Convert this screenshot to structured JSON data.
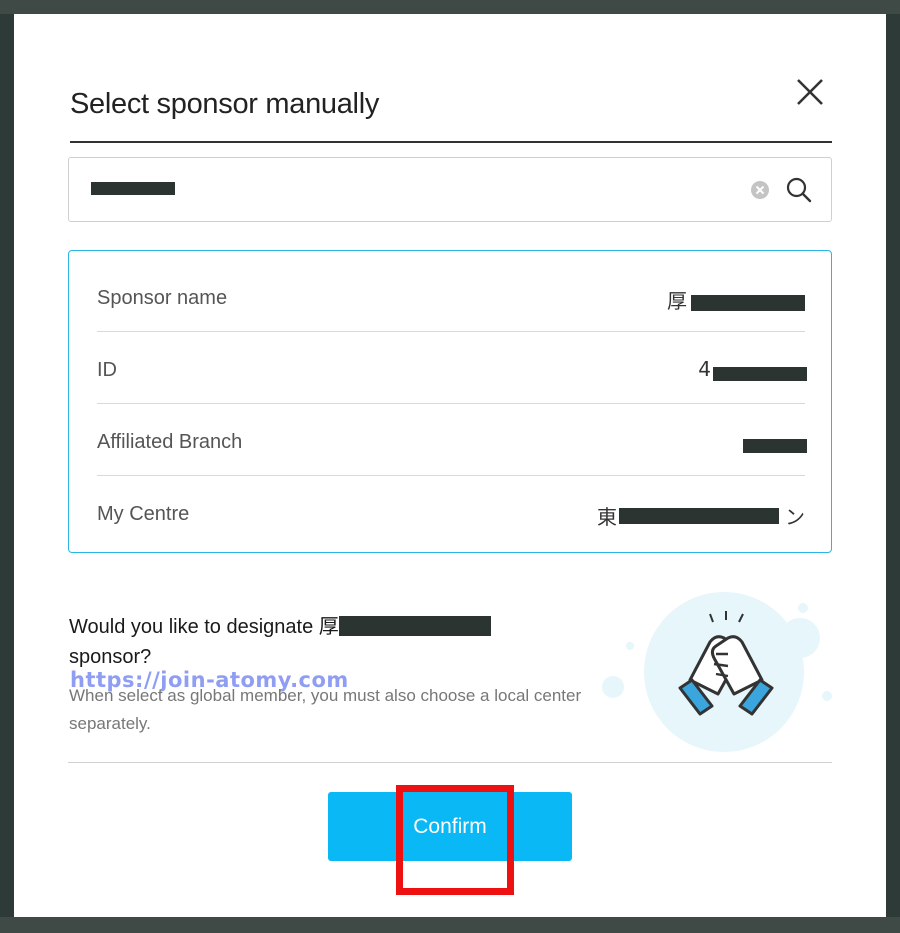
{
  "dialog": {
    "title": "Select sponsor manually",
    "close_icon": "close-icon"
  },
  "search": {
    "value": "",
    "clear_icon": "clear-circle-icon",
    "search_icon": "search-icon"
  },
  "info_rows": [
    {
      "label": "Sponsor name",
      "value": "厚"
    },
    {
      "label": "ID",
      "value": "4"
    },
    {
      "label": "Affiliated Branch",
      "value": ""
    },
    {
      "label": "My Centre",
      "value": "東"
    }
  ],
  "my_centre_suffix": "ン",
  "question": {
    "text_before": "Would you like to designate 厚",
    "text_after": " sponsor?"
  },
  "watermark": "https://join-atomy.com",
  "note": "When select as global member, you must also choose a local center separately.",
  "illustration_icon": "handshake-icon",
  "confirm_label": "Confirm",
  "colors": {
    "accent": "#09b8f4",
    "card_border": "#2bb6e6",
    "highlight": "#ee1111",
    "backdrop": "#2e3a37"
  }
}
